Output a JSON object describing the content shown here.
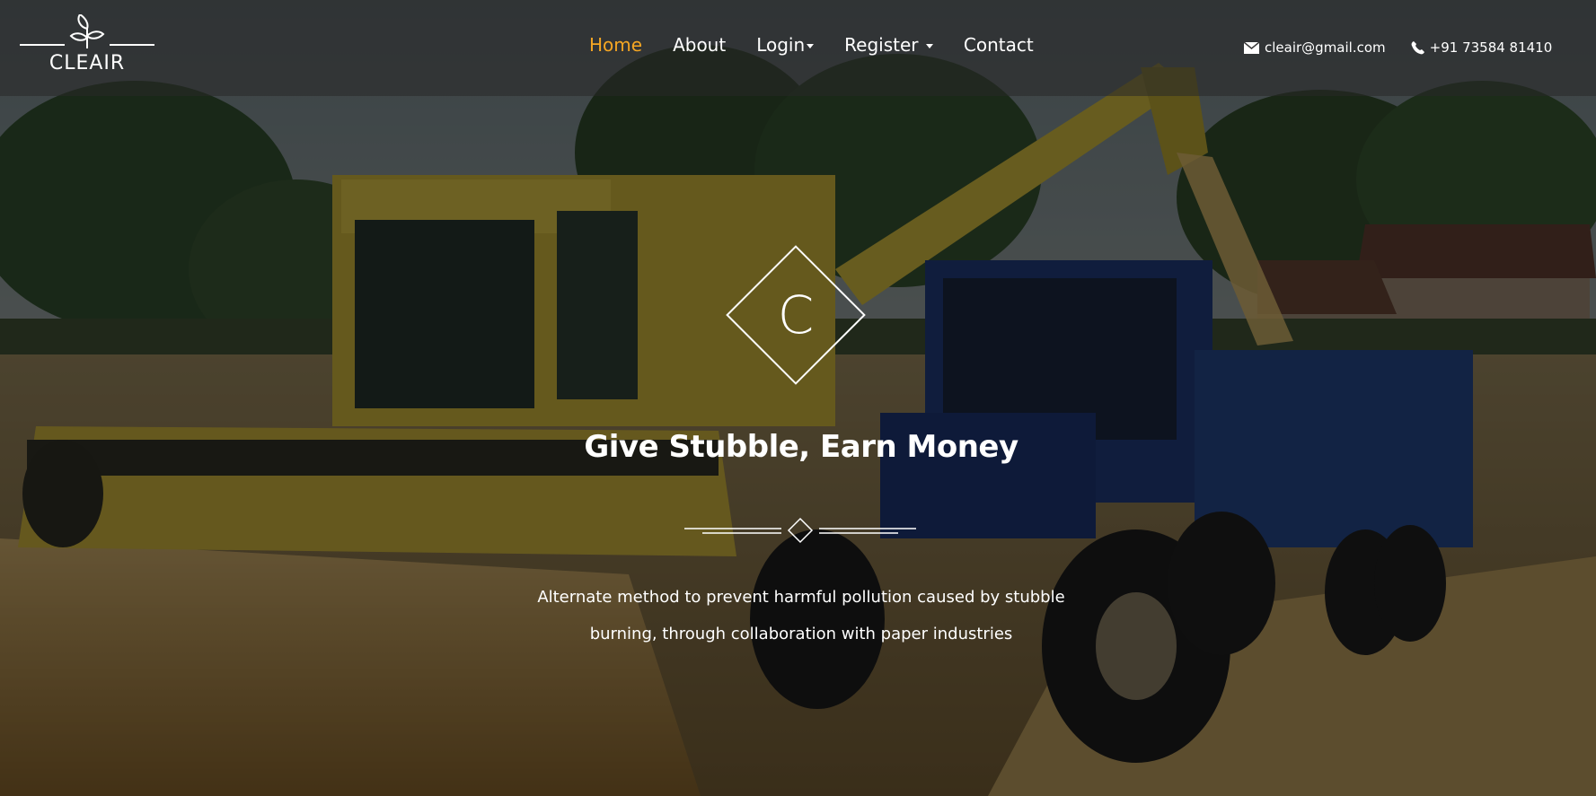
{
  "brand": {
    "name": "CLEAIR"
  },
  "nav": {
    "items": [
      {
        "label": "Home",
        "active": true,
        "dropdown": false
      },
      {
        "label": "About",
        "active": false,
        "dropdown": false
      },
      {
        "label": "Login",
        "active": false,
        "dropdown": true
      },
      {
        "label": "Register",
        "active": false,
        "dropdown": true
      },
      {
        "label": "Contact",
        "active": false,
        "dropdown": false
      }
    ]
  },
  "contact": {
    "email": "cleair@gmail.com",
    "phone": "+91 73584 81410",
    "email_icon": "envelope-icon",
    "phone_icon": "phone-icon"
  },
  "hero": {
    "emblem_letter": "C",
    "headline": "Give Stubble, Earn Money",
    "subtitle": "Alternate method to prevent harmful pollution caused by stubble burning, through collaboration with paper industries"
  },
  "colors": {
    "accent": "#f5a623",
    "text": "#ffffff",
    "navbar_bg": "rgba(40,40,40,0.55)"
  }
}
